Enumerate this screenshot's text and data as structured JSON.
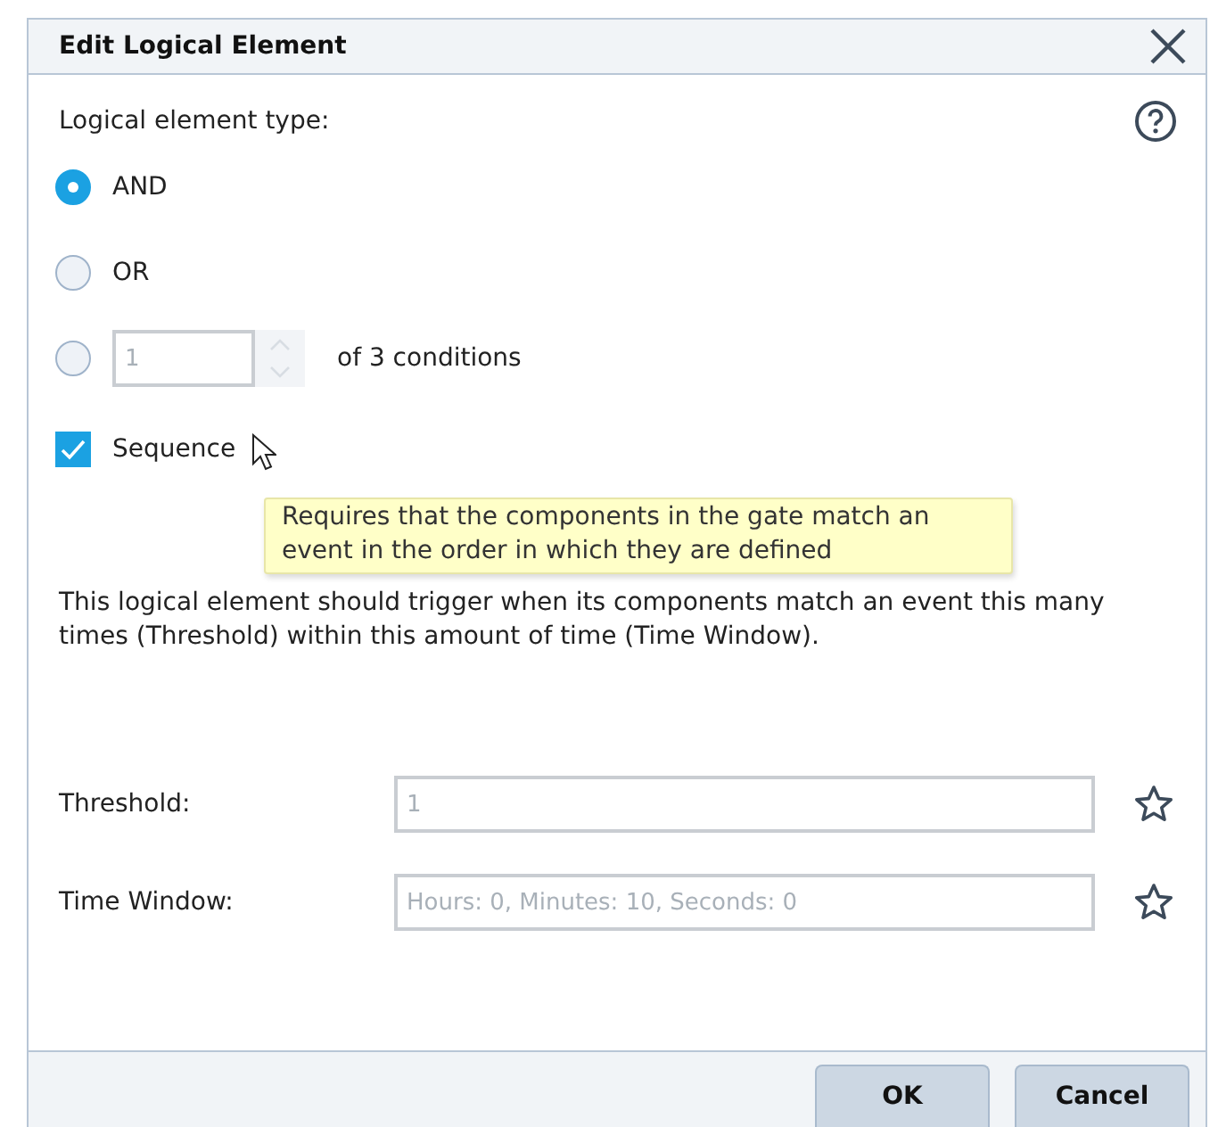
{
  "dialog": {
    "title": "Edit Logical Element"
  },
  "type_label": "Logical element type:",
  "options": [
    {
      "label": "AND",
      "selected": true
    },
    {
      "label": "OR",
      "selected": false
    }
  ],
  "count_option": {
    "selected": false,
    "count": "1",
    "suffix": "of 3 conditions"
  },
  "sequence": {
    "label": "Sequence",
    "checked": true
  },
  "tooltip": "Requires that the components in the gate match an event in the order in which they are defined",
  "description": "This logical element should trigger when its components match an event this many times (Threshold) within this amount of time (Time Window).",
  "fields": [
    {
      "label": "Threshold:",
      "value": "1"
    },
    {
      "label": "Time Window:",
      "value": "Hours: 0, Minutes: 10, Seconds: 0"
    }
  ],
  "buttons": [
    "OK",
    "Cancel"
  ]
}
